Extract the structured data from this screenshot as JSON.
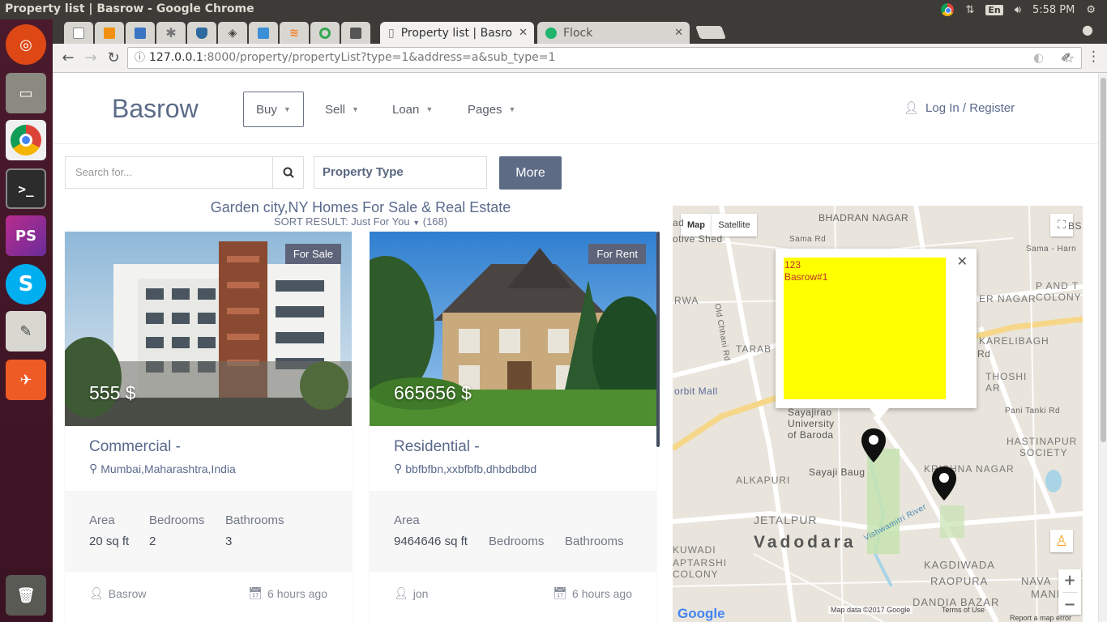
{
  "os": {
    "window_title": "Property list | Basrow - Google Chrome",
    "language": "En",
    "clock": "5:58 PM"
  },
  "launcher": [
    {
      "name": "ubuntu-dash-icon",
      "color": "#dd4814"
    },
    {
      "name": "files-icon",
      "color": "#8a8a80"
    },
    {
      "name": "chrome-icon",
      "color": "#e8e8e8"
    },
    {
      "name": "terminal-icon",
      "color": "#2c2c2c"
    },
    {
      "name": "phpstorm-icon",
      "color": "#b82c8d"
    },
    {
      "name": "skype-icon",
      "color": "#00aff0"
    },
    {
      "name": "text-editor-icon",
      "color": "#d8d8d0"
    },
    {
      "name": "postman-icon",
      "color": "#ef5b25"
    },
    {
      "name": "trash-icon",
      "color": "#5a5a55"
    }
  ],
  "browser": {
    "pinned_tabs": [
      {
        "name": "doc-tab-icon",
        "color": "#888888"
      },
      {
        "name": "phpmyadmin-tab-icon",
        "color": "#f29111",
        "text": "PMA"
      },
      {
        "name": "db-tab-icon",
        "color": "#3a74c4"
      },
      {
        "name": "asterisk-tab-icon",
        "color": "#777777"
      },
      {
        "name": "shield-tab-icon",
        "color": "#2d6aa0"
      },
      {
        "name": "diamond-tab-icon",
        "color": "#444444"
      },
      {
        "name": "bookmark-tab-icon",
        "color": "#3b8fd8"
      },
      {
        "name": "stackoverflow-tab-icon",
        "color": "#f48024"
      },
      {
        "name": "circle-tab-icon",
        "color": "#34a853"
      },
      {
        "name": "floppy-tab-icon",
        "color": "#555555"
      }
    ],
    "tabs": [
      {
        "label": "Property list | Basro",
        "active": true
      },
      {
        "label": "Flock",
        "active": false
      }
    ],
    "url_host": "127.0.0.1",
    "url_path": ":8000/property/propertyList?type=1&address=a&sub_type=1"
  },
  "site": {
    "logo": "Basrow",
    "menu": [
      {
        "label": "Buy"
      },
      {
        "label": "Sell"
      },
      {
        "label": "Loan"
      },
      {
        "label": "Pages"
      }
    ],
    "login": "Log In / Register",
    "search_placeholder": "Search for...",
    "property_type": "Property Type",
    "more_button": "More",
    "list_title": "Garden city,NY Homes For Sale & Real Estate",
    "sort_prefix": "SORT RESULT:",
    "sort_value": "Just For You",
    "result_count": "(168)"
  },
  "properties": [
    {
      "tag": "For Sale",
      "price": "555 $",
      "title": "Commercial -",
      "address": "Mumbai,Maharashtra,India",
      "area_label": "Area",
      "area": "20 sq ft",
      "bedrooms_label": "Bedrooms",
      "bedrooms": "2",
      "bathrooms_label": "Bathrooms",
      "bathrooms": "3",
      "agent": "Basrow",
      "posted": "6 hours ago"
    },
    {
      "tag": "For Rent",
      "price": "665656 $",
      "title": "Residential -",
      "address": "bbfbfbn,xxbfbfb,dhbdbdbd",
      "area_label": "Area",
      "area": "9464646 sq ft",
      "bedrooms_label": "Bedrooms",
      "bedrooms": "",
      "bathrooms_label": "Bathrooms",
      "bathrooms": "",
      "agent": "jon",
      "posted": "6 hours ago"
    }
  ],
  "map": {
    "map_button": "Map",
    "satellite_button": "Satellite",
    "info_line1": "123",
    "info_line2": "Basrow#1",
    "attribution": "Map data ©2017 Google",
    "terms": "Terms of Use",
    "report": "Report a map error",
    "google": "Google",
    "labels": {
      "bhadran": "BHADRAN NAGAR",
      "sama": "Sama Rd",
      "sama_harn": "Sama - Harn",
      "p_and_t_1": "P AND T",
      "p_and_t_2": "COLONY",
      "er_nagar": "ER NAGAR",
      "karelibagh": "KARELIBAGH",
      "tarab": "TARAB",
      "rwa": "RWA",
      "thoshi": "THOSHI",
      "ar": "AR",
      "pani_tanki": "Pani Tanki Rd",
      "orbit": "orbit Mall",
      "sayajirao1": "Sayajirao",
      "sayajirao2": "University",
      "sayajirao3": "of Baroda",
      "hastinapur1": "HASTINAPUR",
      "hastinapur2": "SOCIETY",
      "sayaji_baug": "Sayaji Baug",
      "krishna": "KRISHNA NAGAR",
      "alkapuri": "ALKAPURI",
      "jetalpur": "JETALPUR",
      "vadodara": "Vadodara",
      "kuwadi": "KUWADI",
      "aptarshi1": "APTARSHI",
      "aptarshi2": "COLONY",
      "kagdiwada": "KAGDIWADA",
      "raopura": "RAOPURA",
      "nava": "NAVA",
      "mand": "MAND",
      "dandia": "DANDIA BAZAR",
      "vishwamitri": "Vishwamitri River",
      "old_chhani": "Old Chhani Rd",
      "otive_shed": "otive Shed",
      "ad": "ad",
      "rd_left": "Rd",
      "bs": "BS"
    }
  },
  "colors": {
    "brand": "#5c6b88",
    "accent_button": "#5d6b85",
    "info_bg": "#ffff00",
    "info_text": "#c03030"
  }
}
